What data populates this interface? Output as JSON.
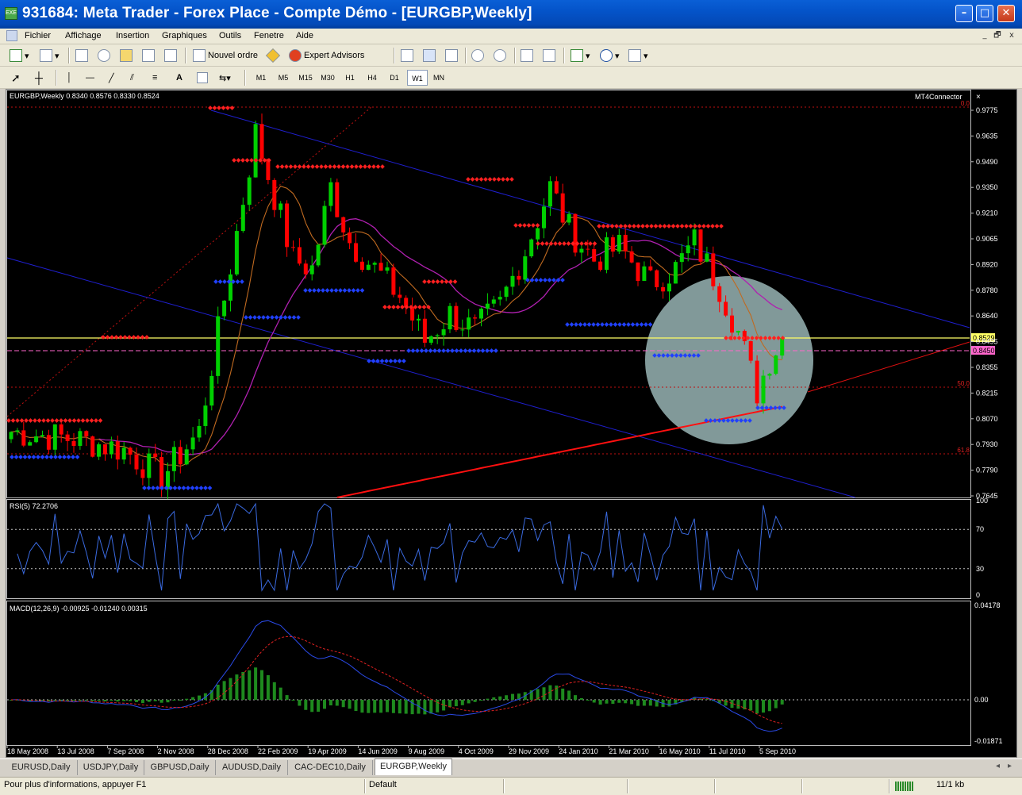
{
  "window": {
    "title": "931684: Meta Trader - Forex Place - Compte Démo - [EURGBP,Weekly]",
    "app_icon": "EXE",
    "minimize": "–",
    "maximize": "□",
    "close": "✕"
  },
  "menu": [
    "Fichier",
    "Affichage",
    "Insertion",
    "Graphiques",
    "Outils",
    "Fenetre",
    "Aide"
  ],
  "mdi_controls": [
    "_",
    "🗗",
    "x"
  ],
  "toolbar": {
    "new_order": "Nouvel ordre",
    "expert_advisors": "Expert Advisors",
    "draw_text": "A",
    "timeframes": [
      "M1",
      "M5",
      "M15",
      "M30",
      "H1",
      "H4",
      "D1",
      "W1",
      "MN"
    ],
    "active_timeframe": "W1"
  },
  "chart": {
    "header": "EURGBP,Weekly  0.8340 0.8576 0.8330 0.8524",
    "ea_label": "MT4Connector",
    "ea_close": "×",
    "price_ticks": [
      "0.9775",
      "0.9635",
      "0.9490",
      "0.9350",
      "0.9210",
      "0.9065",
      "0.8920",
      "0.8780",
      "0.8640",
      "0.8495",
      "0.8355",
      "0.8215",
      "0.8070",
      "0.7930",
      "0.7790",
      "0.7645"
    ],
    "current_price": "0.8529",
    "line_price": "0.8450",
    "fib_labels": [
      "0.0",
      "50.0",
      "61.8"
    ],
    "colors": {
      "bull": "#00d000",
      "bear": "#ff0000",
      "current": "#ffff66",
      "hline": "#ff66cc",
      "channel": "#1f1fd0",
      "circle": "#98b4b4"
    }
  },
  "rsi": {
    "header": "RSI(5) 72.2706",
    "ticks": [
      "100",
      "70",
      "30",
      "0"
    ]
  },
  "macd": {
    "header": "MACD(12,26,9) -0.00925 -0.01240 0.00315",
    "ticks": [
      "0.04178",
      "0.00",
      "-0.01871"
    ]
  },
  "dates": [
    "18 May 2008",
    "13 Jul 2008",
    "7 Sep 2008",
    "2 Nov 2008",
    "28 Dec 2008",
    "22 Feb 2009",
    "19 Apr 2009",
    "14 Jun 2009",
    "9 Aug 2009",
    "4 Oct 2009",
    "29 Nov 2009",
    "24 Jan 2010",
    "21 Mar 2010",
    "16 May 2010",
    "11 Jul 2010",
    "5 Sep 2010"
  ],
  "tabs": [
    "EURUSD,Daily",
    "USDJPY,Daily",
    "GBPUSD,Daily",
    "AUDUSD,Daily",
    "CAC-DEC10,Daily",
    "EURGBP,Weekly"
  ],
  "active_tab": "EURGBP,Weekly",
  "status": {
    "help": "Pour plus d'informations, appuyer F1",
    "profile": "Default",
    "traffic": "11/1 kb"
  }
}
